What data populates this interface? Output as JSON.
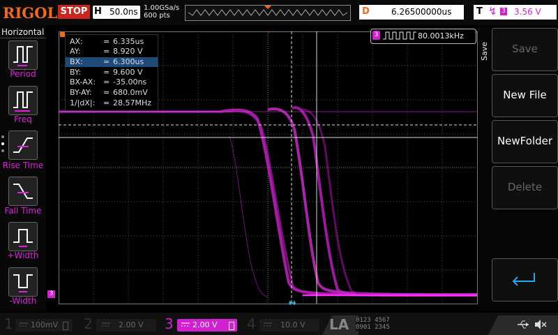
{
  "brand": "RIGOL",
  "run_state": "STOP",
  "timebase": {
    "label": "H",
    "value": "50.0ns"
  },
  "sample_rate": "1.00GSa/s",
  "memory_depth": "600 pts",
  "delay": {
    "label": "D",
    "value": "6.26500000us"
  },
  "trigger": {
    "label": "T",
    "source": "3",
    "level": "3.56 V"
  },
  "left_panel": {
    "title": "Horizontal",
    "items": [
      {
        "label": "Period",
        "icon": "period-icon"
      },
      {
        "label": "Freq",
        "icon": "freq-icon"
      },
      {
        "label": "Rise Time",
        "icon": "rise-time-icon"
      },
      {
        "label": "Fall Time",
        "icon": "fall-time-icon"
      },
      {
        "label": "+Width",
        "icon": "pos-width-icon"
      },
      {
        "label": "-Width",
        "icon": "neg-width-icon"
      }
    ]
  },
  "cursor_readout": [
    {
      "key": "AX:",
      "value": "6.335us"
    },
    {
      "key": "AY:",
      "value": "8.920 V"
    },
    {
      "key": "BX:",
      "value": "6.300us"
    },
    {
      "key": "BY:",
      "value": "9.600 V"
    },
    {
      "key": "BX-AX:",
      "value": "-35.00ns"
    },
    {
      "key": "BY-AY:",
      "value": "680.0mV"
    },
    {
      "key": "1/|dX|:",
      "value": "28.57MHz"
    }
  ],
  "frequency_counter": {
    "channel": "3",
    "value": "80.0013kHz"
  },
  "right_panel": {
    "menu_title": "Save",
    "buttons": [
      {
        "label": "Save",
        "enabled": false
      },
      {
        "label": "New File",
        "enabled": true
      },
      {
        "label": "NewFolder",
        "enabled": true
      },
      {
        "label": "Delete",
        "enabled": false
      }
    ]
  },
  "channels": [
    {
      "num": "1",
      "scale": "100mV",
      "active": false,
      "color": "#e8d020"
    },
    {
      "num": "2",
      "scale": "2.00 V",
      "active": false,
      "color": "#20c8e8"
    },
    {
      "num": "3",
      "scale": "2.00 V",
      "active": true,
      "color": "#d020d0"
    },
    {
      "num": "4",
      "scale": "10.0 V",
      "active": false,
      "color": "#3050e0"
    }
  ],
  "la": {
    "label": "LA",
    "digits_row1": "0123 4567",
    "digits_row2": "8901 2345"
  },
  "colors": {
    "accent": "#f06a1e",
    "channel3": "#d020d0",
    "stop": "#c8261e"
  }
}
